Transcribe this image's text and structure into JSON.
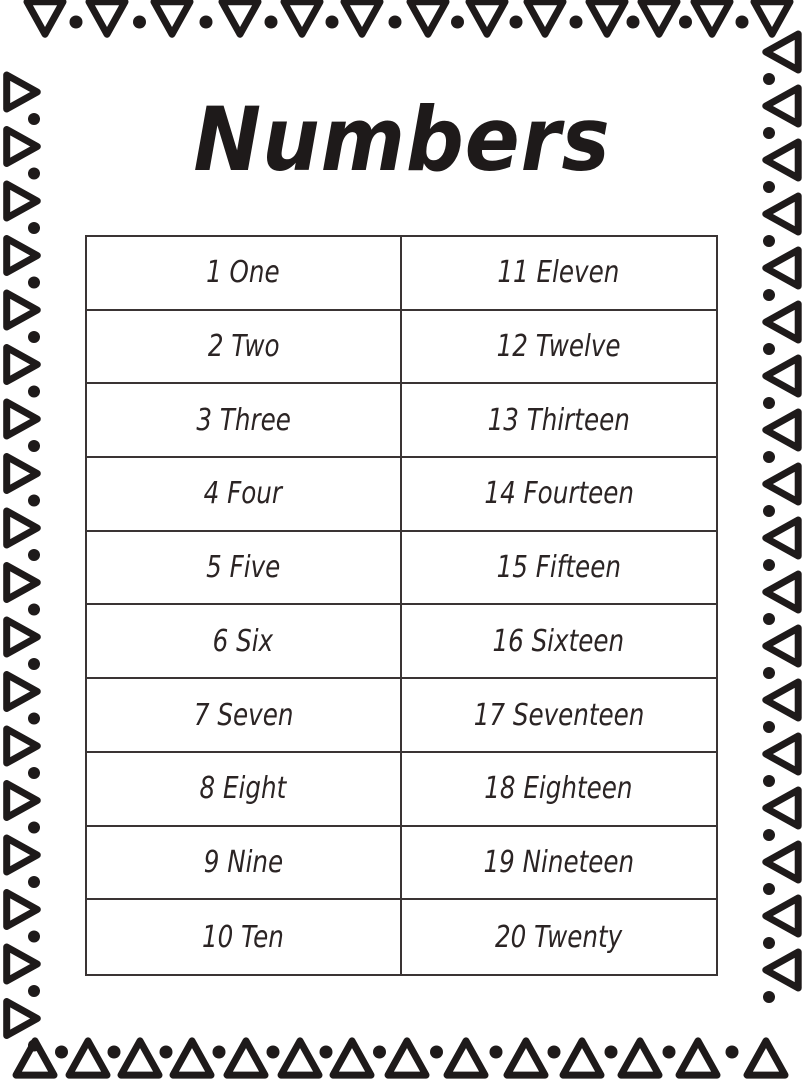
{
  "title": "Numbers",
  "colors": {
    "ink": "#1e1a1a",
    "table_border": "#3a3434",
    "cell_text": "#2b2424",
    "background": "#ffffff"
  },
  "border_decoration": {
    "shape": "triangle-outline-with-dot",
    "orientation": "pointing-inward"
  },
  "rows": [
    {
      "left": "1 One",
      "right": "11 Eleven"
    },
    {
      "left": "2 Two",
      "right": "12 Twelve"
    },
    {
      "left": "3 Three",
      "right": "13 Thirteen"
    },
    {
      "left": "4 Four",
      "right": "14 Fourteen"
    },
    {
      "left": "5 Five",
      "right": "15 Fifteen"
    },
    {
      "left": "6 Six",
      "right": "16 Sixteen"
    },
    {
      "left": "7 Seven",
      "right": "17 Seventeen"
    },
    {
      "left": "8 Eight",
      "right": "18 Eighteen"
    },
    {
      "left": "9 Nine",
      "right": "19 Nineteen"
    },
    {
      "left": "10 Ten",
      "right": "20 Twenty"
    }
  ]
}
